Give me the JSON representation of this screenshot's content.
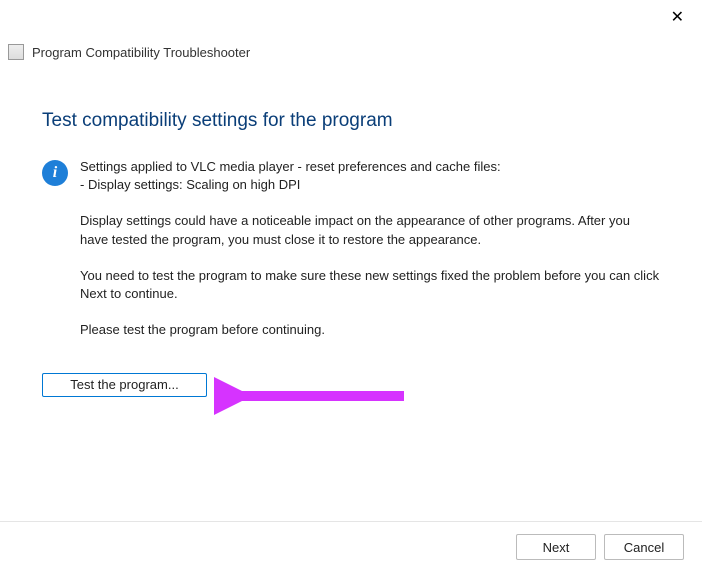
{
  "close_label": "✕",
  "window_title": "Program Compatibility Troubleshooter",
  "heading": "Test compatibility settings for the program",
  "info_line1": "Settings applied to VLC media player - reset preferences and cache files:",
  "info_line2": "- Display settings:  Scaling on high DPI",
  "para1": "Display settings could have a noticeable impact on the appearance of other programs. After you have tested the program, you must close it to restore the appearance.",
  "para2": "You need to test the program to make sure these new settings fixed the problem before you can click Next to continue.",
  "para3": "Please test the program before continuing.",
  "test_button": "Test the program...",
  "next_button": "Next",
  "cancel_button": "Cancel",
  "info_glyph": "i",
  "arrow_color": "#d633ff"
}
